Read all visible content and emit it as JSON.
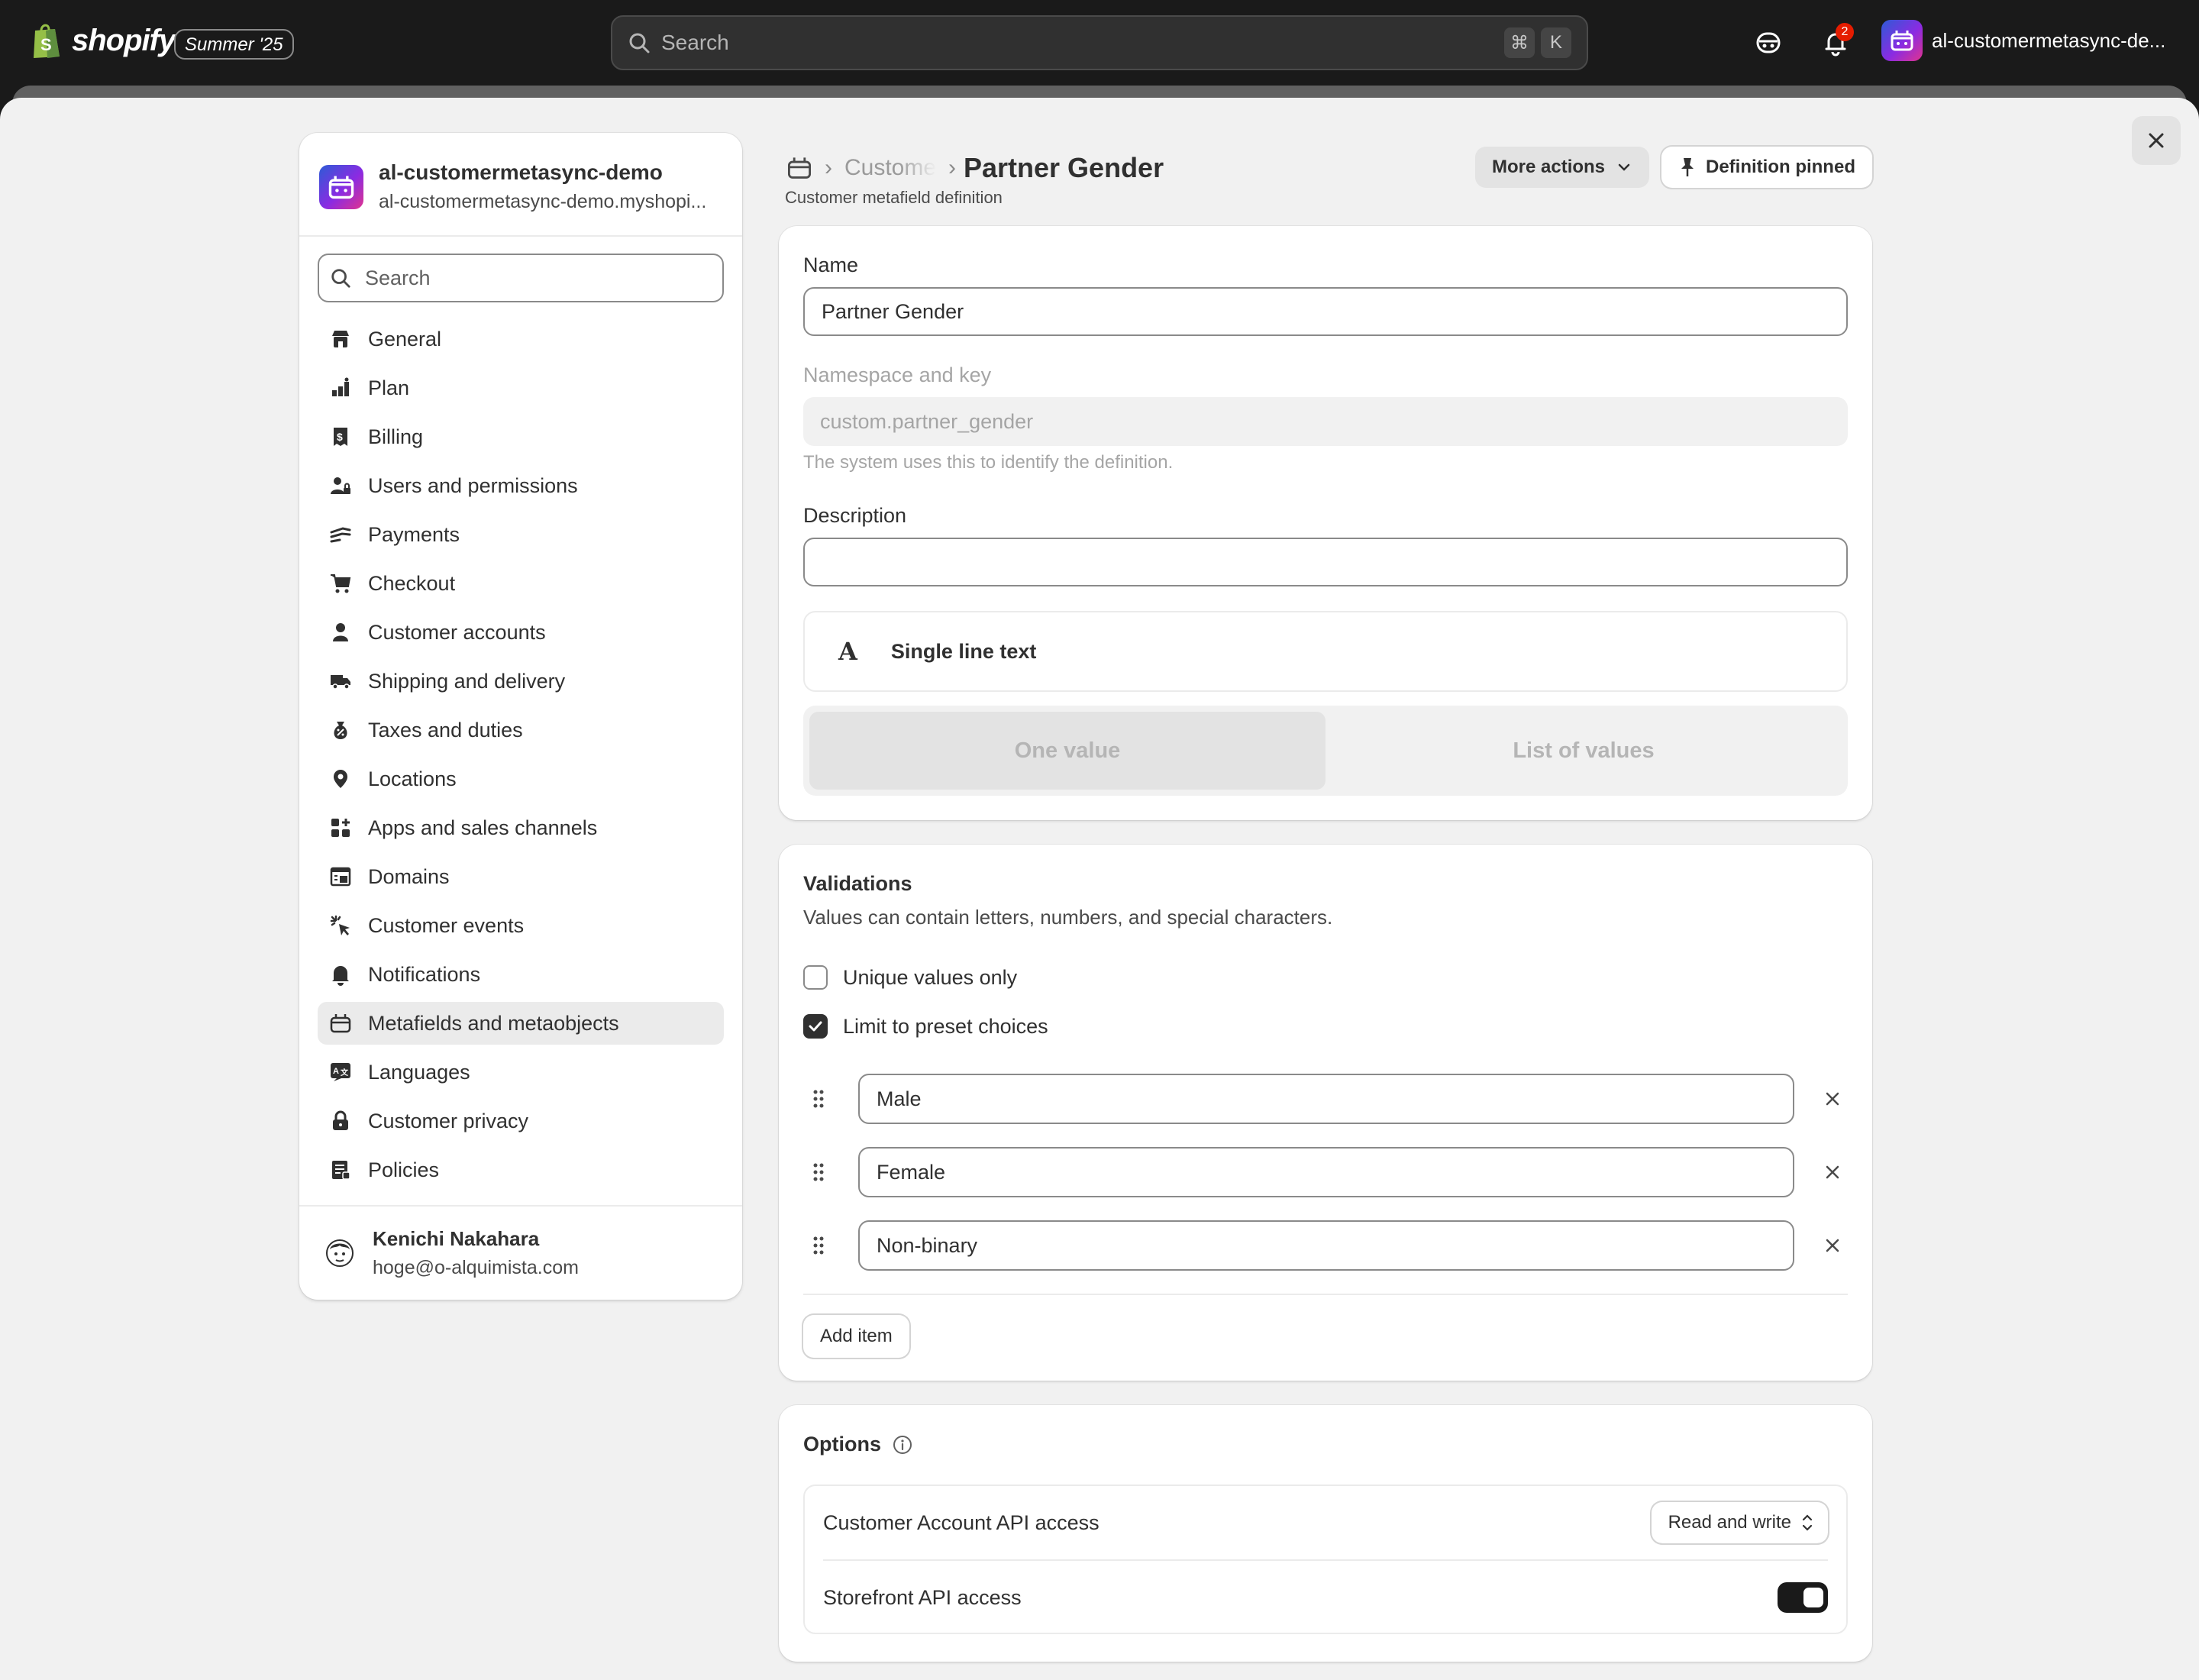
{
  "topbar": {
    "brand": "shopify",
    "edition": "Summer '25",
    "search_placeholder": "Search",
    "shortcut_keys": [
      "⌘",
      "K"
    ],
    "notification_count": "2",
    "store_name": "al-customermetasync-de..."
  },
  "sidebar": {
    "store_title": "al-customermetasync-demo",
    "store_domain": "al-customermetasync-demo.myshopi...",
    "search_placeholder": "Search",
    "items": [
      {
        "label": "General",
        "icon": "store-icon"
      },
      {
        "label": "Plan",
        "icon": "plan-icon"
      },
      {
        "label": "Billing",
        "icon": "receipt-dollar-icon"
      },
      {
        "label": "Users and permissions",
        "icon": "person-lock-icon"
      },
      {
        "label": "Payments",
        "icon": "hand-payment-icon"
      },
      {
        "label": "Checkout",
        "icon": "cart-icon"
      },
      {
        "label": "Customer accounts",
        "icon": "person-icon"
      },
      {
        "label": "Shipping and delivery",
        "icon": "truck-icon"
      },
      {
        "label": "Taxes and duties",
        "icon": "money-bag-icon"
      },
      {
        "label": "Locations",
        "icon": "location-pin-icon"
      },
      {
        "label": "Apps and sales channels",
        "icon": "apps-icon"
      },
      {
        "label": "Domains",
        "icon": "globe-window-icon"
      },
      {
        "label": "Customer events",
        "icon": "cursor-click-icon"
      },
      {
        "label": "Notifications",
        "icon": "bell-icon"
      },
      {
        "label": "Metafields and metaobjects",
        "icon": "metafield-icon",
        "active": true
      },
      {
        "label": "Languages",
        "icon": "translate-icon"
      },
      {
        "label": "Customer privacy",
        "icon": "lock-icon"
      },
      {
        "label": "Policies",
        "icon": "policy-icon"
      }
    ],
    "user_name": "Kenichi Nakahara",
    "user_email": "hoge@o-alquimista.com"
  },
  "header": {
    "breadcrumb_parent": "Customers",
    "title": "Partner Gender",
    "subtitle": "Customer metafield definition",
    "more_actions": "More actions",
    "pinned": "Definition pinned"
  },
  "definition": {
    "name_label": "Name",
    "name_value": "Partner Gender",
    "ns_label": "Namespace and key",
    "ns_value": "custom.partner_gender",
    "ns_help": "The system uses this to identify the definition.",
    "desc_label": "Description",
    "desc_value": "",
    "type_name": "Single line text",
    "one_value": "One value",
    "list_values": "List of values"
  },
  "validations": {
    "title": "Validations",
    "desc": "Values can contain letters, numbers, and special characters.",
    "unique_label": "Unique values only",
    "unique_checked": false,
    "limit_label": "Limit to preset choices",
    "limit_checked": true,
    "choices": [
      "Male",
      "Female",
      "Non-binary"
    ],
    "add_item": "Add item"
  },
  "options": {
    "title": "Options",
    "customer_api_label": "Customer Account API access",
    "customer_api_value": "Read and write",
    "storefront_label": "Storefront API access",
    "storefront_on": true
  },
  "colors": {
    "topbar": "#1a1a1a",
    "page_bg": "#f1f1f1",
    "text": "#303030",
    "notification_red": "#e51c00"
  }
}
